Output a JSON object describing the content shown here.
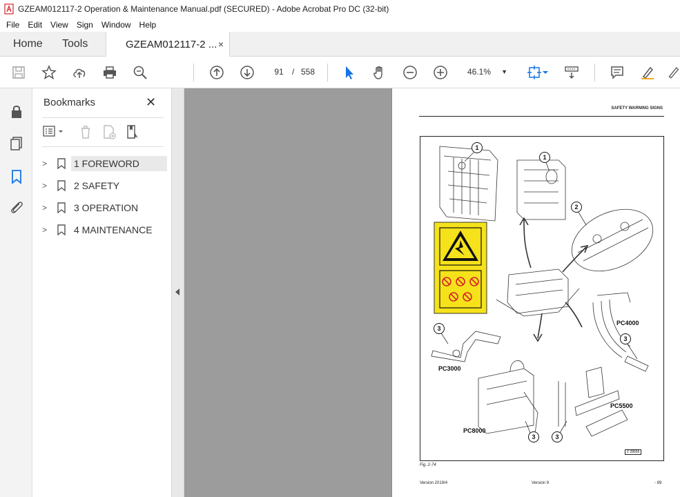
{
  "window": {
    "title": "GZEAM012117-2 Operation & Maintenance Manual.pdf (SECURED) - Adobe Acrobat Pro DC (32-bit)"
  },
  "menu": [
    "File",
    "Edit",
    "View",
    "Sign",
    "Window",
    "Help"
  ],
  "tabs": {
    "home": "Home",
    "tools": "Tools",
    "document": "GZEAM012117-2 ...",
    "document_close": "×"
  },
  "toolbar": {
    "page_current": "91",
    "page_separator": "/",
    "page_total": "558",
    "zoom": "46.1%"
  },
  "bookmarks": {
    "title": "Bookmarks",
    "close": "✕",
    "items": [
      {
        "label": "1 FOREWORD",
        "selected": true
      },
      {
        "label": "2 SAFETY",
        "selected": false
      },
      {
        "label": "3 OPERATION",
        "selected": false
      },
      {
        "label": "4 MAINTENANCE",
        "selected": false
      }
    ]
  },
  "page": {
    "header": "SAFETY WARNING SIGNS",
    "figure_caption": "Fig. 2-74",
    "footer_left": "Version 2019/4",
    "footer_center": "Version 9",
    "footer_right": "- 89",
    "figure": {
      "labels": {
        "pc4000": "PC4000",
        "pc3000": "PC3000",
        "pc8000": "PC8000",
        "pc5500": "PC5500"
      },
      "callouts": [
        "1",
        "1",
        "2",
        "3",
        "3",
        "3",
        "3"
      ],
      "ref": "Z 28656"
    }
  },
  "colors": {
    "accent_blue": "#1473e6",
    "warning_yellow": "#f5e21a",
    "canvas_gray": "#9c9c9c",
    "adobe_red": "#d6242a"
  }
}
